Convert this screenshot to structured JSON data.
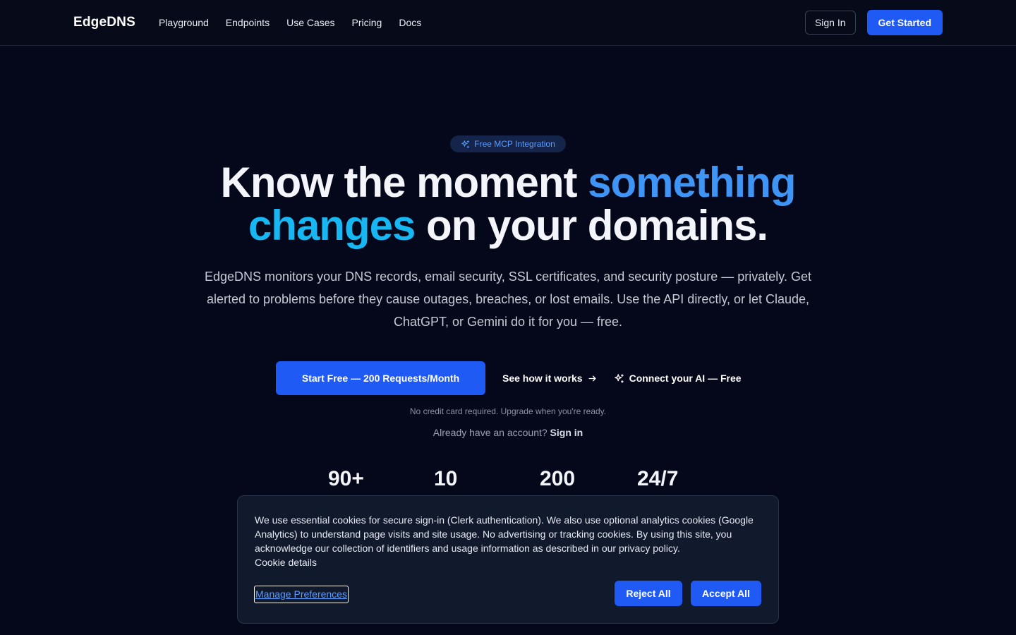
{
  "nav": {
    "logo": "EdgeDNS",
    "links": [
      "Playground",
      "Endpoints",
      "Use Cases",
      "Pricing",
      "Docs"
    ],
    "sign_in": "Sign In",
    "get_started": "Get Started"
  },
  "hero": {
    "badge": "Free MCP Integration",
    "badge_icon": "sparkle-icon",
    "title_part1": "Know the moment ",
    "title_highlight1": "something",
    "title_highlight2": "changes",
    "title_part2": " on your domains.",
    "subtitle": "EdgeDNS monitors your DNS records, email security, SSL certificates, and security posture — privately. Get alerted to problems before they cause outages, breaches, or lost emails. Use the API directly, or let Claude, ChatGPT, or Gemini do it for you — free.",
    "cta_primary": "Start Free — 200 Requests/Month",
    "cta_how": "See how it works",
    "cta_ai": "Connect your AI — Free",
    "note": "No credit card required. Upgrade when you're ready.",
    "account_prefix": "Already have an account?",
    "account_signin": "Sign in"
  },
  "stats": [
    "90+",
    "10",
    "200",
    "24/7"
  ],
  "cookie": {
    "text": "We use essential cookies for secure sign-in (Clerk authentication). We also use optional analytics cookies (Google Analytics) to understand page visits and site usage. No advertising or tracking cookies. By using this site, you acknowledge our collection of identifiers and usage information as described in our privacy policy.",
    "details": "Cookie details",
    "manage": "Manage Preferences",
    "reject": "Reject All",
    "accept": "Accept All"
  },
  "colors": {
    "background": "#05081a",
    "accent": "#1f5af5",
    "highlight_blue": "#3f95f5",
    "highlight_cyan": "#16b7f2"
  }
}
